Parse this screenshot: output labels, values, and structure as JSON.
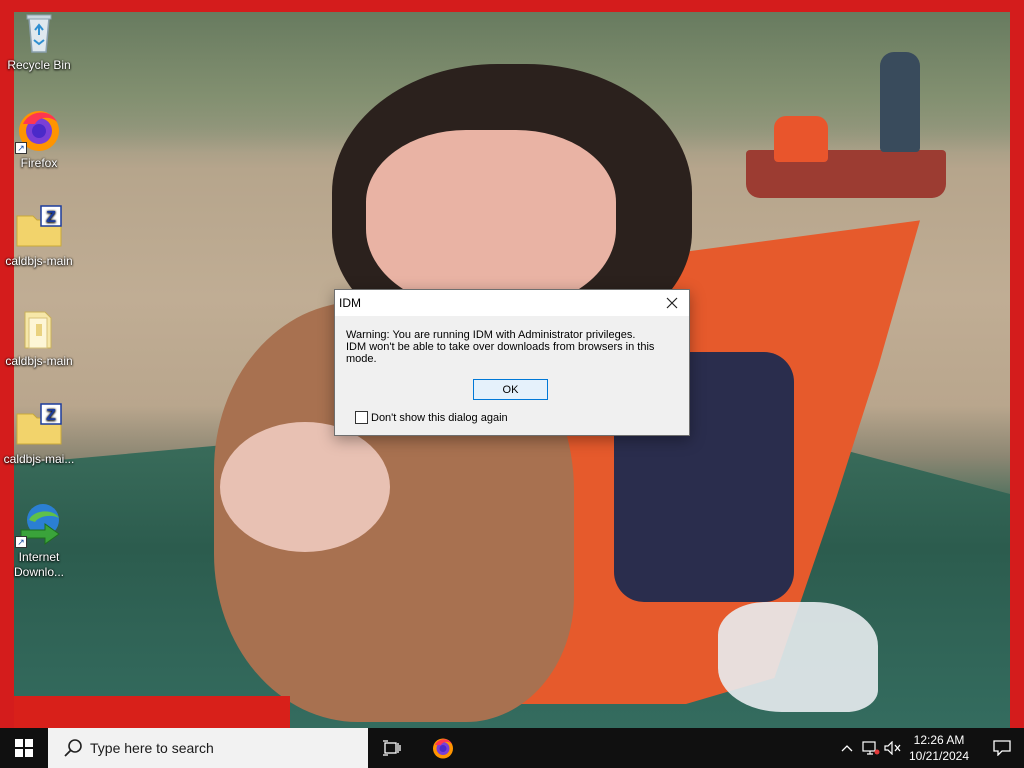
{
  "desktop": {
    "icons": [
      {
        "label": "Recycle Bin",
        "icon": "recycle-bin-icon"
      },
      {
        "label": "Firefox",
        "icon": "firefox-icon"
      },
      {
        "label": "caldbjs-main",
        "icon": "zip-folder-icon"
      },
      {
        "label": "caldbjs-main",
        "icon": "folder-icon"
      },
      {
        "label": "caldbjs-mai...",
        "icon": "zip-folder-icon"
      },
      {
        "label": "Internet Downlo...",
        "icon": "idm-icon"
      }
    ]
  },
  "dialog": {
    "title": "IDM",
    "message_line1": "Warning: You are running IDM with Administrator privileges.",
    "message_line2": "IDM won't be able to take over downloads from browsers in this mode.",
    "ok_label": "OK",
    "checkbox_label": "Don't show this dialog again",
    "checkbox_checked": false
  },
  "taskbar": {
    "search_placeholder": "Type here to search",
    "pinned": [
      "task-view-icon",
      "firefox-icon"
    ],
    "tray_icons": [
      "chevron-up-icon",
      "network-icon",
      "volume-muted-icon"
    ],
    "time": "12:26 AM",
    "date": "10/21/2024"
  },
  "colors": {
    "frame_border": "#d41c1c",
    "taskbar": "#101010",
    "dialog_bg": "#f0f0f0",
    "ok_border": "#0078d7"
  }
}
